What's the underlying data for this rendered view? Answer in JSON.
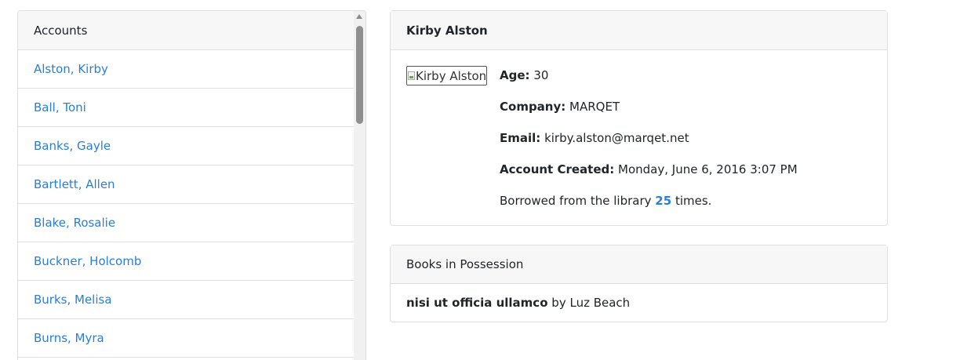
{
  "accounts": {
    "header": "Accounts",
    "items": [
      "Alston, Kirby",
      "Ball, Toni",
      "Banks, Gayle",
      "Bartlett, Allen",
      "Blake, Rosalie",
      "Buckner, Holcomb",
      "Burks, Melisa",
      "Burns, Myra"
    ]
  },
  "detail": {
    "name": "Kirby Alston",
    "image_alt": "Kirby Alston",
    "age_label": "Age:",
    "age": "30",
    "company_label": "Company:",
    "company": "MARQET",
    "email_label": "Email:",
    "email": "kirby.alston@marqet.net",
    "created_label": "Account Created:",
    "created": "Monday, June 6, 2016 3:07 PM",
    "borrow_prefix": "Borrowed from the library",
    "borrow_count": "25",
    "borrow_suffix": "times."
  },
  "books": {
    "header": "Books in Possession",
    "items": [
      {
        "title": "nisi ut officia ullamco",
        "by": "by",
        "author": "Luz Beach"
      }
    ]
  },
  "colors": {
    "link": "#2a7fd4",
    "header_bg": "#f7f7f7",
    "border": "#dfdfdf"
  }
}
